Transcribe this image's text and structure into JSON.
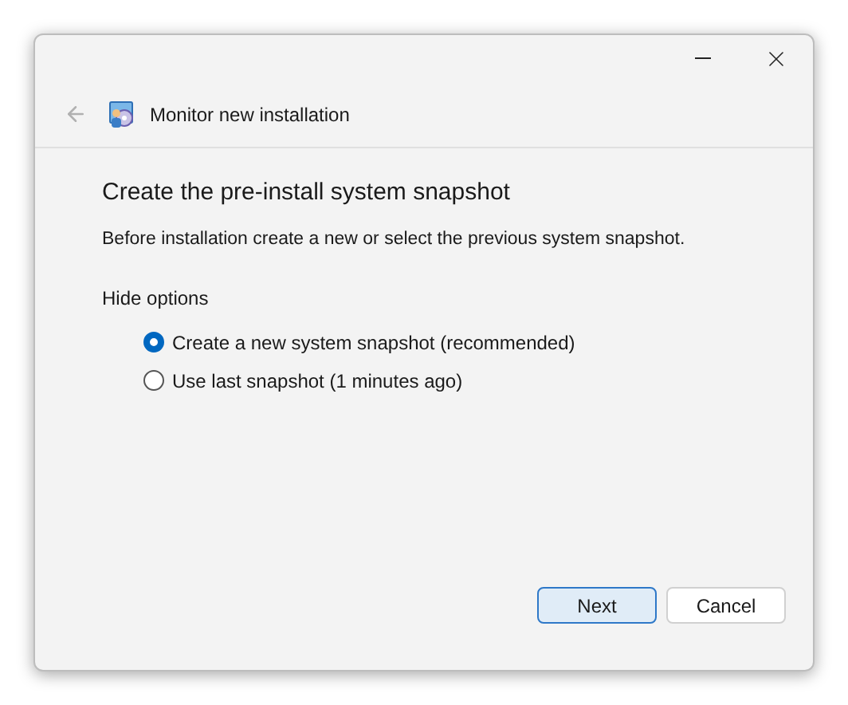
{
  "window": {
    "title": "Monitor new installation"
  },
  "heading": "Create the pre-install system snapshot",
  "description": "Before installation create a new or select the previous system snapshot.",
  "options_toggle": "Hide options",
  "options": [
    {
      "label": "Create a new system snapshot (recommended)",
      "selected": true
    },
    {
      "label": "Use last snapshot (1 minutes ago)",
      "selected": false
    }
  ],
  "buttons": [
    {
      "label": "Next",
      "default": true
    },
    {
      "label": "Cancel",
      "default": false
    }
  ]
}
